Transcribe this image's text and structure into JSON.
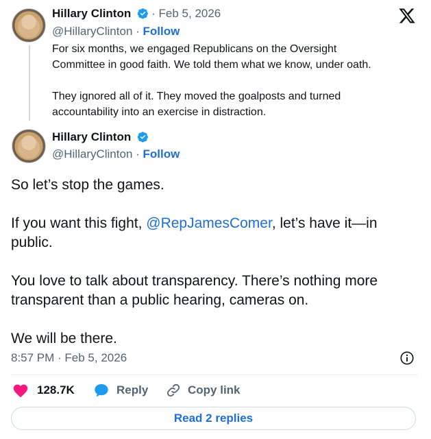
{
  "quoted": {
    "author_name": "Hillary Clinton",
    "date": "· Feb 5, 2026",
    "handle": "@HillaryClinton ·",
    "follow": "Follow",
    "lines": [
      "For six months, we engaged Republicans on the Oversight",
      "Committee in good faith. We told them what we know, under oath.",
      "",
      "They ignored all of it. They moved the goalposts and turned",
      "accountability into an exercise in distraction."
    ]
  },
  "main": {
    "author_name": "Hillary Clinton",
    "handle": "@HillaryClinton ·",
    "follow": "Follow",
    "line1": "So let’s stop the games.",
    "line2a": "If you want this fight, ",
    "mention": "@RepJamesComer",
    "line2b": ", let’s have it—in",
    "line3": "public.",
    "line4": "You love to talk about transparency. There’s nothing more",
    "line5": "transparent than a public hearing, cameras on.",
    "line6": "We will be there.",
    "timestamp": "8:57 PM · Feb 5, 2026"
  },
  "actions": {
    "likes": "128.7K",
    "reply": "Reply",
    "copy_link": "Copy link"
  },
  "read_replies": "Read 2 replies",
  "colors": {
    "accent": "#1d6fd6",
    "like": "#f91880",
    "verified": "#1d9bf0"
  },
  "icons": [
    "x-logo-icon",
    "verified-badge-icon",
    "heart-icon",
    "reply-bubble-icon",
    "link-icon",
    "info-icon"
  ]
}
